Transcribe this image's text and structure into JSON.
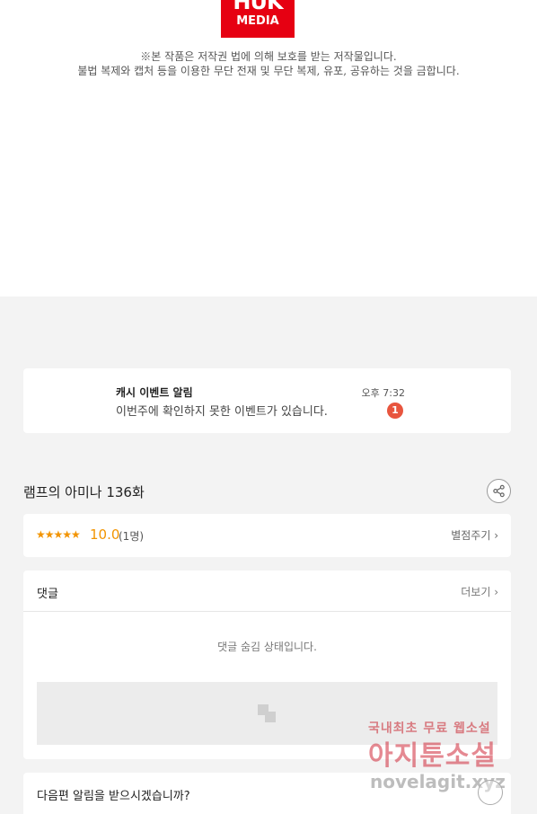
{
  "logo": {
    "line1": "HUK",
    "line2": "MEDIA"
  },
  "copyright": {
    "line1": "※본 작품은 저작권 법에 의해 보호를 받는 저작물입니다.",
    "line2": "불법 복제와 캡처 등을 이용한 무단 전재 및 무단 복제, 유포, 공유하는 것을 금합니다."
  },
  "notice": {
    "title": "캐시 이벤트 알림",
    "text": "이번주에 확인하지 못한 이벤트가 있습니다.",
    "time": "오후 7:32",
    "badge": "1"
  },
  "episode": {
    "title": "램프의 아미나 136화"
  },
  "rating": {
    "stars": "★★★★★",
    "score": "10.0",
    "count": "(1명)",
    "rate_label": "별점주기 ›"
  },
  "comments": {
    "title": "댓글",
    "more_label": "더보기 ›",
    "hidden_msg": "댓글 숨김 상태입니다."
  },
  "next_alert": {
    "question": "다음편 알림을 받으시겠습니까?"
  },
  "watermark": {
    "line1": "국내최초 무료 웹소설",
    "line2": "아지툰소설",
    "line3": "novelagit.xyz"
  },
  "colors": {
    "accent": "#f29400",
    "badge": "#e8553e",
    "logo": "#e60012"
  }
}
